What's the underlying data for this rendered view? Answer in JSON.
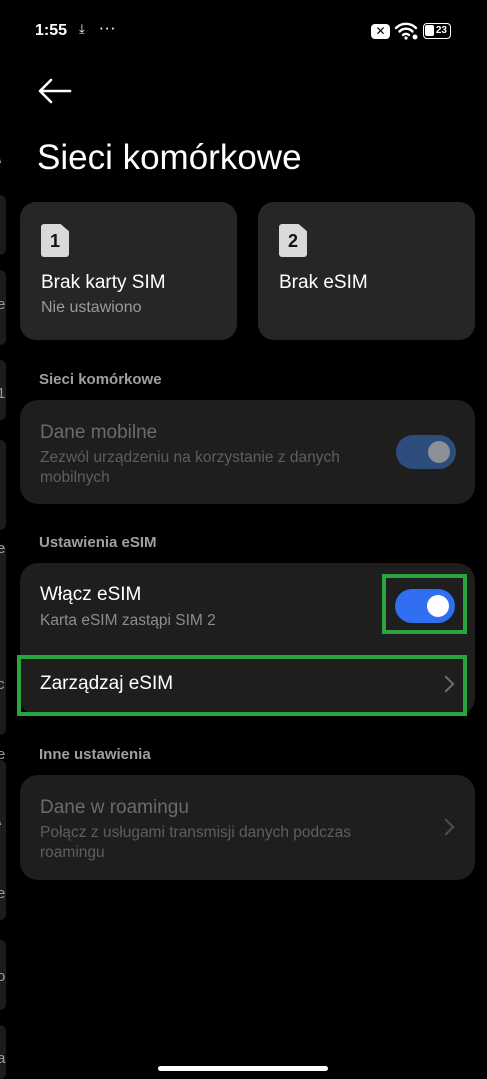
{
  "status_bar": {
    "time": "1:55",
    "download_glyph": "⤓",
    "more_glyph": "···",
    "battery_level": "23"
  },
  "header": {
    "back_icon": "arrow-left-icon",
    "title": "Sieci komórkowe"
  },
  "sim_cards": [
    {
      "slot": "1",
      "name": "Brak karty SIM",
      "status": "Nie ustawiono"
    },
    {
      "slot": "2",
      "name": "Brak eSIM",
      "status": ""
    }
  ],
  "mobile_networks": {
    "section_title": "Sieci komórkowe",
    "mobile_data": {
      "title": "Dane mobilne",
      "subtitle": "Zezwól urządzeniu na korzystanie z danych mobilnych",
      "enabled": true,
      "disabled_state": true
    }
  },
  "esim_settings": {
    "section_title": "Ustawienia eSIM",
    "enable_esim": {
      "title": "Włącz eSIM",
      "subtitle": "Karta eSIM zastąpi SIM 2",
      "enabled": true
    },
    "manage_esim": {
      "title": "Zarządzaj eSIM"
    }
  },
  "other_settings": {
    "section_title": "Inne ustawienia",
    "roaming": {
      "title": "Dane w roamingu",
      "subtitle": "Połącz z usługami transmisji danych podczas roamingu"
    }
  },
  "background_peek_glyphs": [
    "\\",
    "e",
    "1",
    "I",
    "e",
    "c",
    "e",
    "\\",
    "e",
    "o",
    "a"
  ],
  "colors": {
    "toggle_on": "#2f6ff0",
    "toggle_on_disabled": "#2d4d7c",
    "highlight": "#2aa43c",
    "card_bg": "#262626",
    "group_bg": "#1e1e1e"
  }
}
